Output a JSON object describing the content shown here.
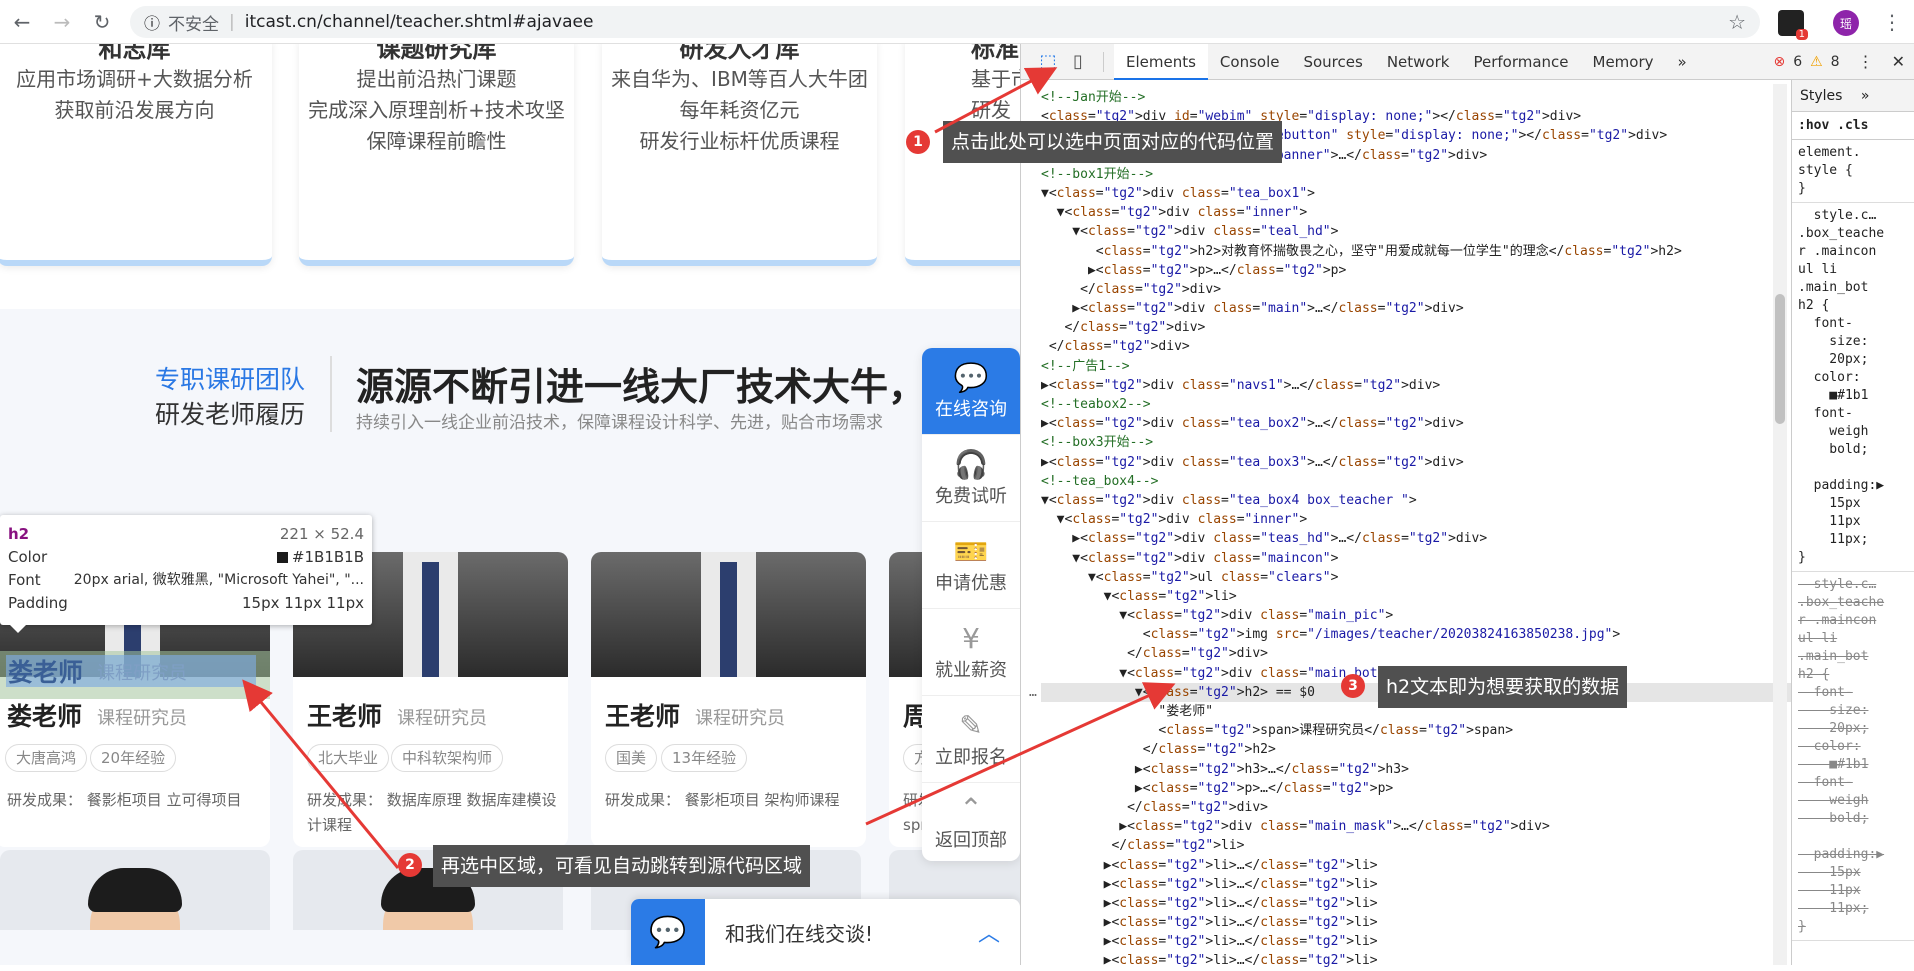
{
  "browser": {
    "insecure_label": "不安全",
    "url": "itcast.cn/channel/teacher.shtml#ajavaee",
    "ext_badge": "1",
    "profile_letter": "瑶"
  },
  "top_cards": [
    {
      "title": "和志库",
      "lines": [
        "应用市场调研+大数据分析",
        "获取前沿发展方向"
      ]
    },
    {
      "title": "课题研究库",
      "lines": [
        "提出前沿热门课题",
        "完成深入原理剖析+技术攻坚",
        "保障课程前瞻性"
      ]
    },
    {
      "title": "研发人才库",
      "lines": [
        "来自华为、IBM等百人大牛团",
        "每年耗资亿元",
        "研发行业标杆优质课程"
      ]
    },
    {
      "title": "标准",
      "lines": [
        "基于市",
        "研发"
      ]
    }
  ],
  "team": {
    "blue": "专职课研团队",
    "black": "研发老师履历",
    "headline": "源源不断引进一线大厂技术大牛，",
    "sub": "持续引入一线企业前沿技术，保障课程设计科学、先进，贴合市场需求"
  },
  "teachers": [
    {
      "name": "娄老师",
      "role": "课程研究员",
      "tags": [
        "大唐高鸿",
        "20年经验"
      ],
      "result": "研发成果：  餐影柜项目 立可得项目"
    },
    {
      "name": "王老师",
      "role": "课程研究员",
      "tags": [
        "北大毕业",
        "中科软架构师"
      ],
      "result": "研发成果：  数据库原理 数据库建模设计课程"
    },
    {
      "name": "王老师",
      "role": "课程研究员",
      "tags": [
        "国美",
        "13年经验"
      ],
      "result": "研发成果：  餐影柜项目 架构师课程"
    },
    {
      "name": "周",
      "role": "",
      "tags": [
        "方"
      ],
      "result": "研发 spring"
    }
  ],
  "side_menu": [
    {
      "icon": "💬",
      "label": "在线咨询"
    },
    {
      "icon": "🎧",
      "label": "免费试听"
    },
    {
      "icon": "🎫",
      "label": "申请优惠"
    },
    {
      "icon": "¥",
      "label": "就业薪资"
    },
    {
      "icon": "✎",
      "label": "立即报名"
    },
    {
      "icon": "⌃",
      "label": "返回顶部"
    }
  ],
  "chat": {
    "text": "和我们在线交谈!"
  },
  "tooltip": {
    "tag": "h2",
    "size": "221 × 52.4",
    "color_label": "Color",
    "color_value": "#1B1B1B",
    "font_label": "Font",
    "font_value": "20px arial, 微软雅黑, \"Microsoft Yahei\", \"...",
    "padding_label": "Padding",
    "padding_value": "15px 11px 11px"
  },
  "devtools": {
    "tabs": [
      "Elements",
      "Console",
      "Sources",
      "Network",
      "Performance",
      "Memory"
    ],
    "more": "»",
    "errors": "6",
    "warnings": "8",
    "styles_tab": "Styles",
    "styles_more": "»",
    "filter": ":hov  .cls"
  },
  "code_lines": [
    "<!--Jan开始-->",
    "<div id=\"webim\" style=\"display: none;\"></div>",
    "<div id=\"webimclosebutton\" style=\"display: none;\"></div>",
    "<div class=\"...er_banner\">…</div>",
    "<!--box1开始-->",
    "▼<div class=\"tea_box1\">",
    "  ▼<div class=\"inner\">",
    "    ▼<div class=\"teal_hd\">",
    "       <h2>对教育怀揣敬畏之心，坚守\"用爱成就每一位学生\"的理念</h2>",
    "      ▶<p>…</p>",
    "     </div>",
    "    ▶<div class=\"main\">…</div>",
    "   </div>",
    " </div>",
    "<!--广告1-->",
    "▶<div class=\"navs1\">…</div>",
    "<!--teabox2-->",
    "▶<div class=\"tea_box2\">…</div>",
    "<!--box3开始-->",
    "▶<div class=\"tea_box3\">…</div>",
    "<!--tea_box4-->",
    "▼<div class=\"tea_box4 box_teacher \">",
    "  ▼<div class=\"inner\">",
    "    ▶<div class=\"teas_hd\">…</div>",
    "    ▼<div class=\"maincon\">",
    "      ▼<ul class=\"clears\">",
    "        ▼<li>",
    "          ▼<div class=\"main_pic\">",
    "             <img src=\"/images/teacher/20203824163850238.jpg\">",
    "           </div>",
    "          ▼<div class=\"main_bot\">",
    "            ▼<h2> == $0",
    "               \"娄老师\"",
    "               <span>课程研究员</span>",
    "             </h2>",
    "            ▶<h3>…</h3>",
    "            ▶<p>…</p>",
    "           </div>",
    "          ▶<div class=\"main_mask\">…</div>",
    "         </li>",
    "        ▶<li>…</li>",
    "        ▶<li>…</li>",
    "        ▶<li>…</li>",
    "        ▶<li>…</li>",
    "        ▶<li>…</li>",
    "        ▶<li>…</li>"
  ],
  "styles_blocks": [
    "element.\nstyle {\n}",
    "  style.c…\n.box_teache\nr .maincon\nul li\n.main_bot\nh2 {\n  font-\n    size:\n    20px;\n  color:\n    ■#1b1\n  font-\n    weigh\n    bold;\n\n  padding:▶\n    15px\n    11px\n    11px;\n}",
    "  style.c…\n.box_teache\nr .maincon\nul li\n.main_bot\nh2 {\n  font-\n    size:\n    20px;\n  color:\n    ■#1b1\n  font-\n    weigh\n    bold;\n\n  padding:▶\n    15px\n    11px\n    11px;\n}"
  ],
  "annotations": [
    {
      "num": "1",
      "text": "点击此处可以选中页面对应的代码位置"
    },
    {
      "num": "2",
      "text": "再选中区域，可看见自动跳转到源代码区域"
    },
    {
      "num": "3",
      "text": "h2文本即为想要获取的数据"
    }
  ],
  "colors": {
    "accent": "#2b7be6",
    "annotation_bg": "#505050",
    "arrow": "#e53935"
  }
}
